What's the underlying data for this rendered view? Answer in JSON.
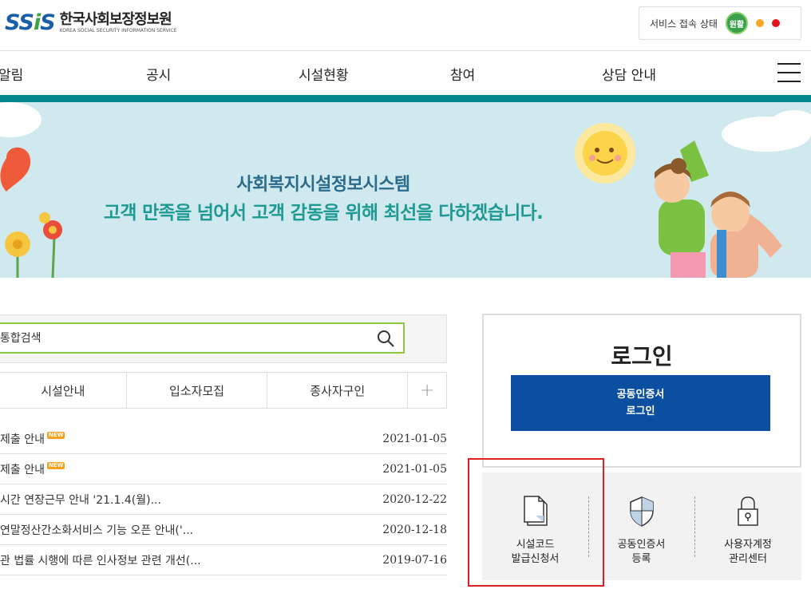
{
  "header": {
    "logo_mark": "SSiS",
    "logo_title": "한국사회보장정보원",
    "logo_subtitle": "KOREA SOCIAL SECURITY INFORMATION SERVICE",
    "status_label": "서비스 접속 상태",
    "status_badge": "원활",
    "status_colors": {
      "good": "#3aa14a",
      "warn": "#f5a623",
      "bad": "#e3131b"
    }
  },
  "nav": {
    "items": [
      "알림",
      "공시",
      "시설현황",
      "참여",
      "상담 안내"
    ],
    "menu_icon": "hamburger-icon"
  },
  "banner": {
    "line1": "사회복지시설정보시스템",
    "line2": "고객 만족을 넘어서 고객 감동을 위해 최선을 다하겠습니다."
  },
  "search": {
    "placeholder": "통합검색",
    "icon": "search-icon"
  },
  "tabs": [
    "시설안내",
    "입소자모집",
    "종사자구인",
    "+"
  ],
  "notices": [
    {
      "title": "제출 안내",
      "new": "NEW",
      "date": "2021-01-05"
    },
    {
      "title": "제출 안내",
      "new": "NEW",
      "date": "2021-01-05"
    },
    {
      "title": "시간 연장근무 안내 '21.1.4(월)...",
      "new": "",
      "date": "2020-12-22"
    },
    {
      "title": "연말정산간소화서비스 기능 오픈 안내('...",
      "new": "",
      "date": "2020-12-18"
    },
    {
      "title": "관 법률 시행에 따른 인사정보 관련 개선(...",
      "new": "",
      "date": "2019-07-16"
    }
  ],
  "login": {
    "title": "로그인",
    "button": "공동인증서\n로그인"
  },
  "services": [
    {
      "label": "시설코드\n발급신청서",
      "icon": "document-icon"
    },
    {
      "label": "공동인증서\n등록",
      "icon": "shield-icon"
    },
    {
      "label": "사용자계정\n관리센터",
      "icon": "lock-icon"
    }
  ],
  "colors": {
    "teal": "#00898a",
    "login_blue": "#0c4fa0",
    "search_green": "#8dc63f",
    "highlight_red": "#e02020"
  }
}
